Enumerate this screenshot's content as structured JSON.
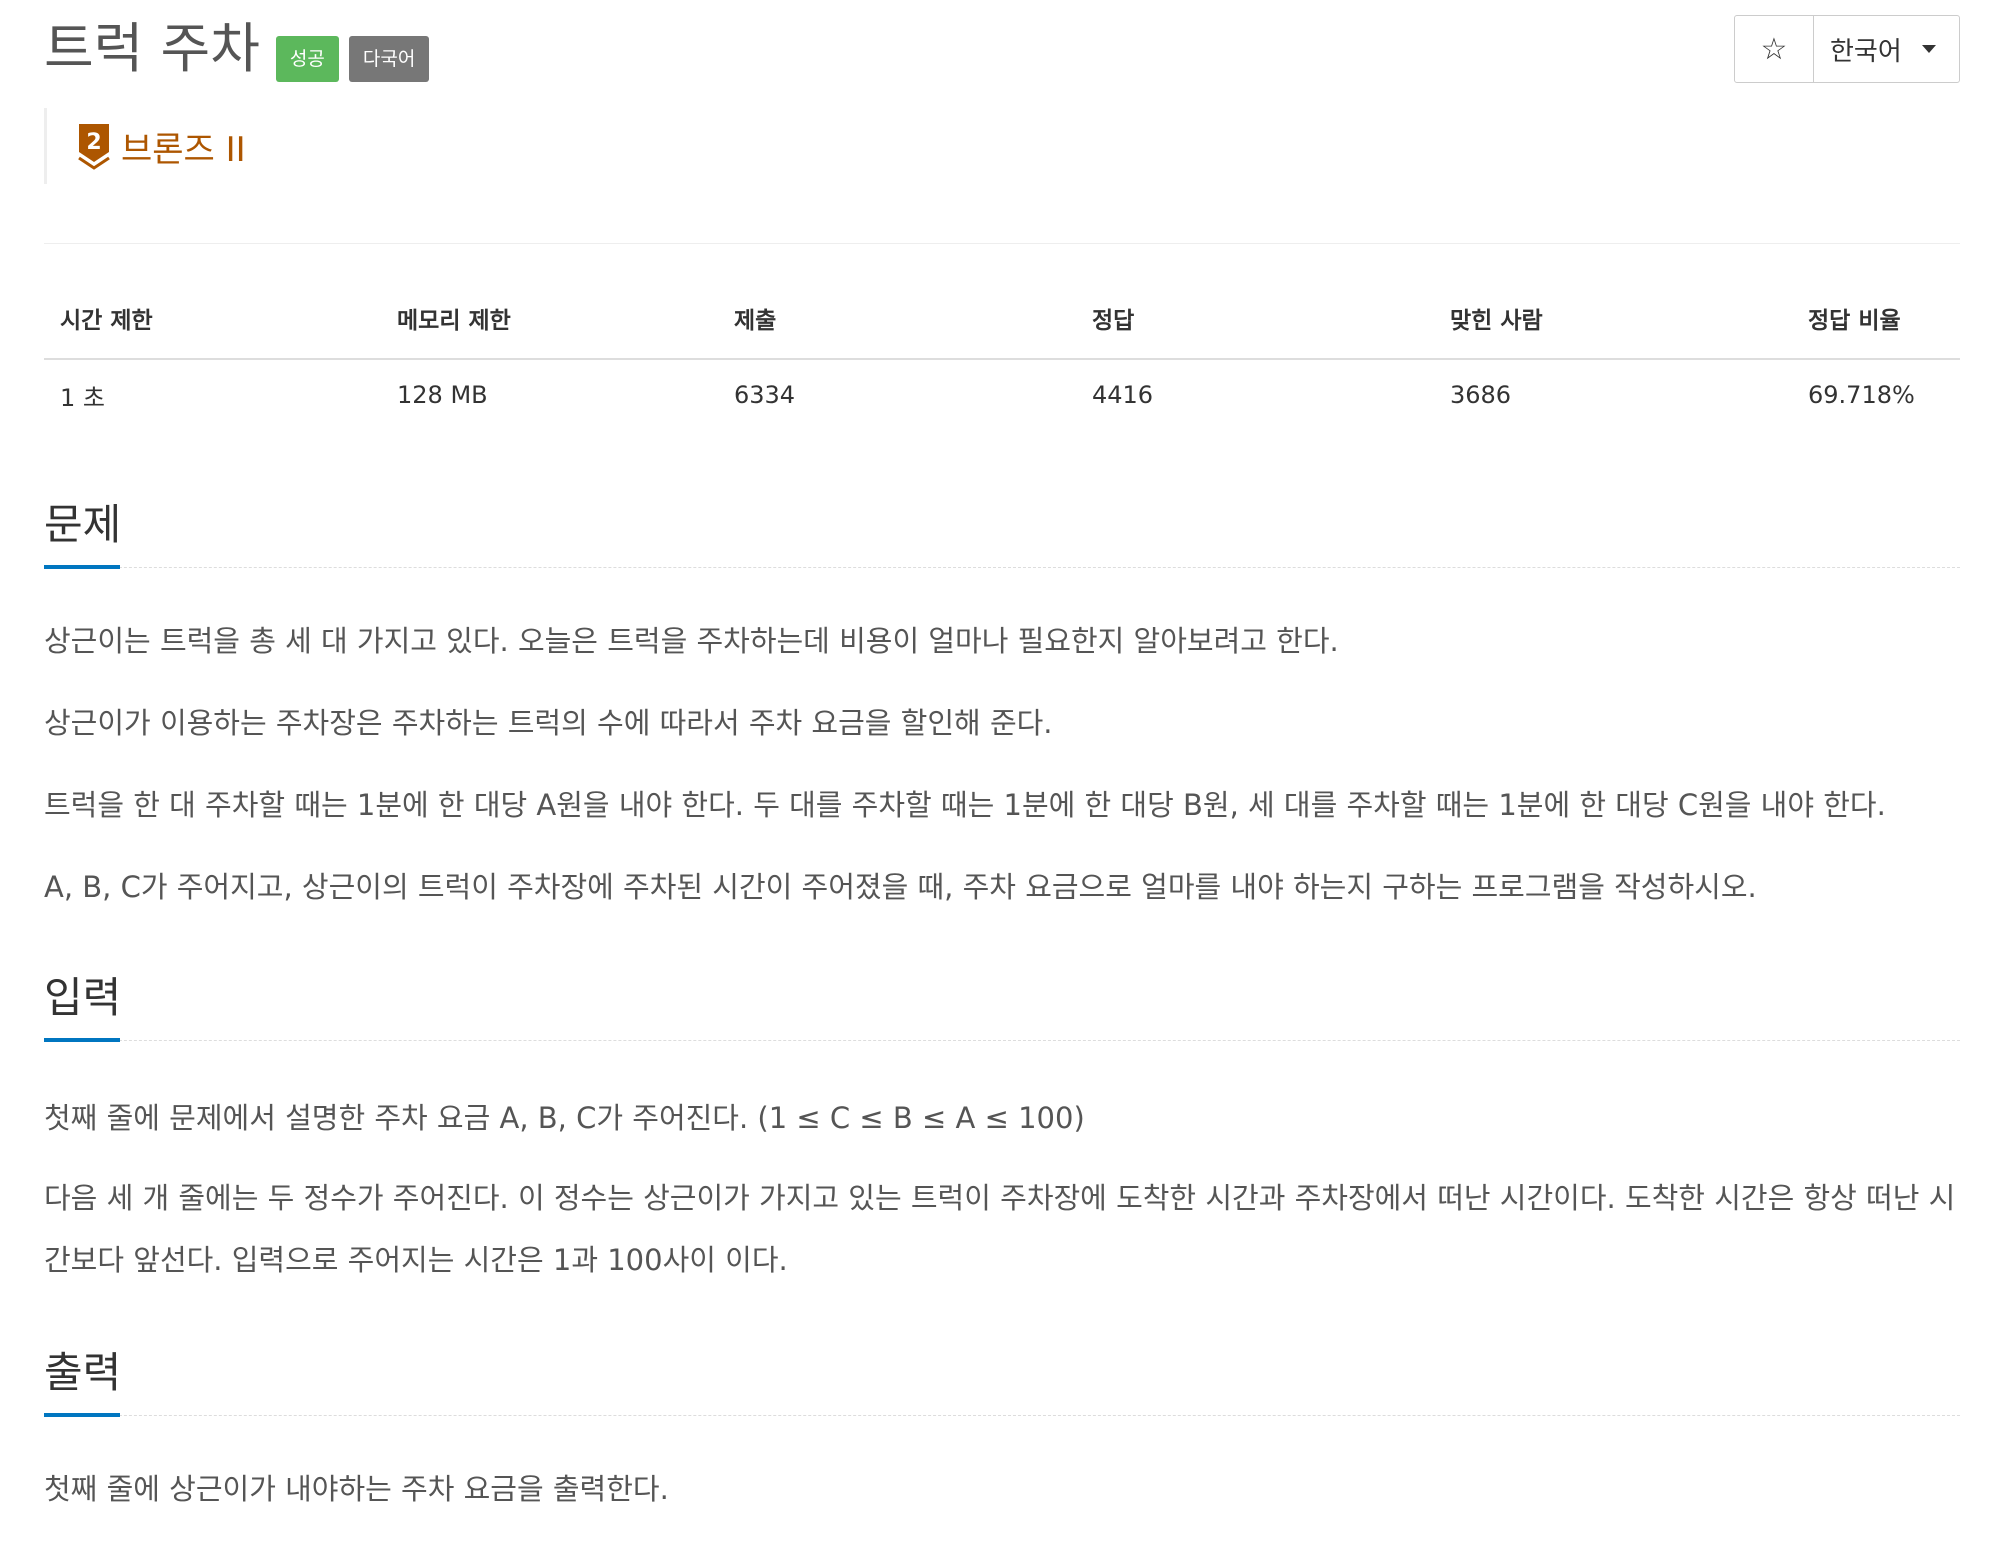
{
  "problem": {
    "title": "트럭 주차",
    "badges": {
      "success": "성공",
      "multilang": "다국어"
    },
    "tier": {
      "label": "브론즈 II",
      "number": "2",
      "color": "#ad5600"
    }
  },
  "controls": {
    "star_icon": "star-icon",
    "language": "한국어"
  },
  "info_table": {
    "headers": [
      "시간 제한",
      "메모리 제한",
      "제출",
      "정답",
      "맞힌 사람",
      "정답 비율"
    ],
    "values": [
      "1 초",
      "128 MB",
      "6334",
      "4416",
      "3686",
      "69.718%"
    ]
  },
  "sections": {
    "description": {
      "title": "문제",
      "paragraphs": [
        "상근이는 트럭을 총 세 대 가지고 있다. 오늘은 트럭을 주차하는데 비용이 얼마나 필요한지 알아보려고 한다.",
        "상근이가 이용하는 주차장은 주차하는 트럭의 수에 따라서 주차 요금을 할인해 준다.",
        "트럭을 한 대 주차할 때는 1분에 한 대당 A원을 내야 한다. 두 대를 주차할 때는 1분에 한 대당 B원, 세 대를 주차할 때는 1분에 한 대당 C원을 내야 한다.",
        "A, B, C가 주어지고, 상근이의 트럭이 주차장에 주차된 시간이 주어졌을 때, 주차 요금으로 얼마를 내야 하는지 구하는 프로그램을 작성하시오."
      ]
    },
    "input": {
      "title": "입력",
      "paragraphs": [
        "첫째 줄에 문제에서 설명한 주차 요금 A, B, C가 주어진다. (1 ≤ C ≤ B ≤ A ≤ 100)",
        "다음 세 개 줄에는 두 정수가 주어진다. 이 정수는 상근이가 가지고 있는 트럭이 주차장에 도착한 시간과 주차장에서 떠난 시간이다. 도착한 시간은 항상 떠난 시간보다 앞선다. 입력으로 주어지는 시간은 1과 100사이 이다."
      ]
    },
    "output": {
      "title": "출력",
      "paragraphs": [
        "첫째 줄에 상근이가 내야하는 주차 요금을 출력한다."
      ]
    }
  }
}
